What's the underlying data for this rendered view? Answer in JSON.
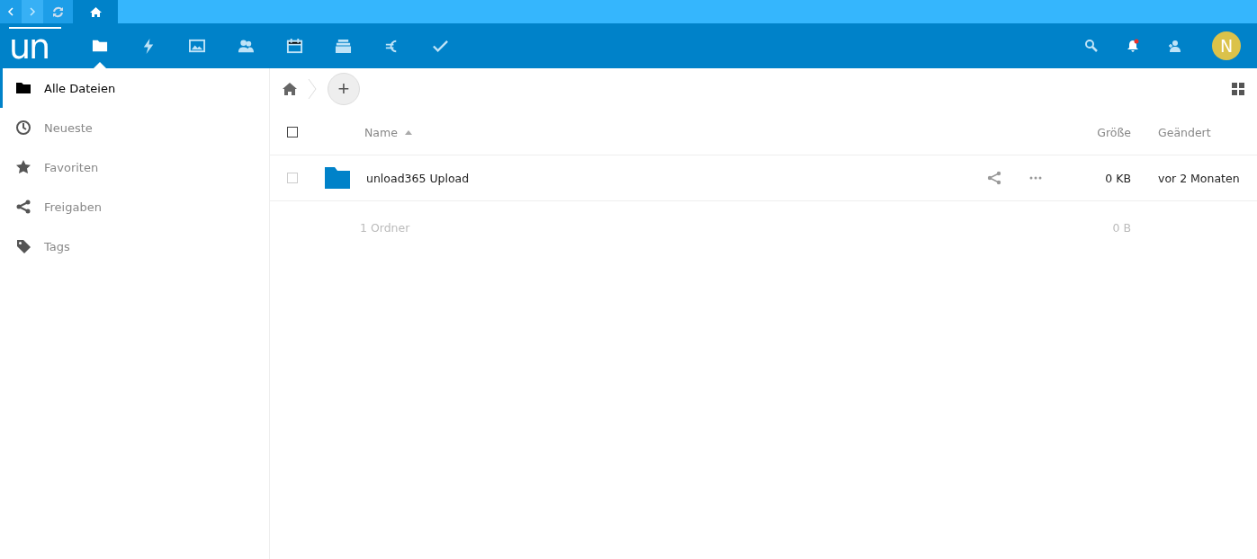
{
  "browser_bar": {
    "back_disabled": false,
    "forward_disabled": true
  },
  "header": {
    "logo": "un",
    "apps": [
      {
        "selected": true
      },
      {
        "selected": false
      },
      {
        "selected": false
      },
      {
        "selected": false
      },
      {
        "selected": false
      },
      {
        "selected": false
      },
      {
        "selected": false
      },
      {
        "selected": false
      }
    ],
    "notifications_unread": true,
    "avatar": "N"
  },
  "sidebar": {
    "items": [
      {
        "label": "Alle Dateien",
        "selected": true
      },
      {
        "label": "Neueste",
        "selected": false
      },
      {
        "label": "Favoriten",
        "selected": false
      },
      {
        "label": "Freigaben",
        "selected": false
      },
      {
        "label": "Tags",
        "selected": false
      }
    ]
  },
  "breadcrumb": {
    "new_button": "+"
  },
  "table": {
    "select_all_checked": false,
    "columns": [
      {
        "label": "Name",
        "sorted_ascending": true
      },
      {
        "label": "Größe"
      },
      {
        "label": "Geändert"
      }
    ],
    "rows": [
      {
        "name": "unload365 Upload",
        "size": "0 KB",
        "modified": "vor 2 Monaten",
        "checked": false
      }
    ],
    "summary": {
      "count": "1 Ordner",
      "size": "0 B"
    }
  }
}
